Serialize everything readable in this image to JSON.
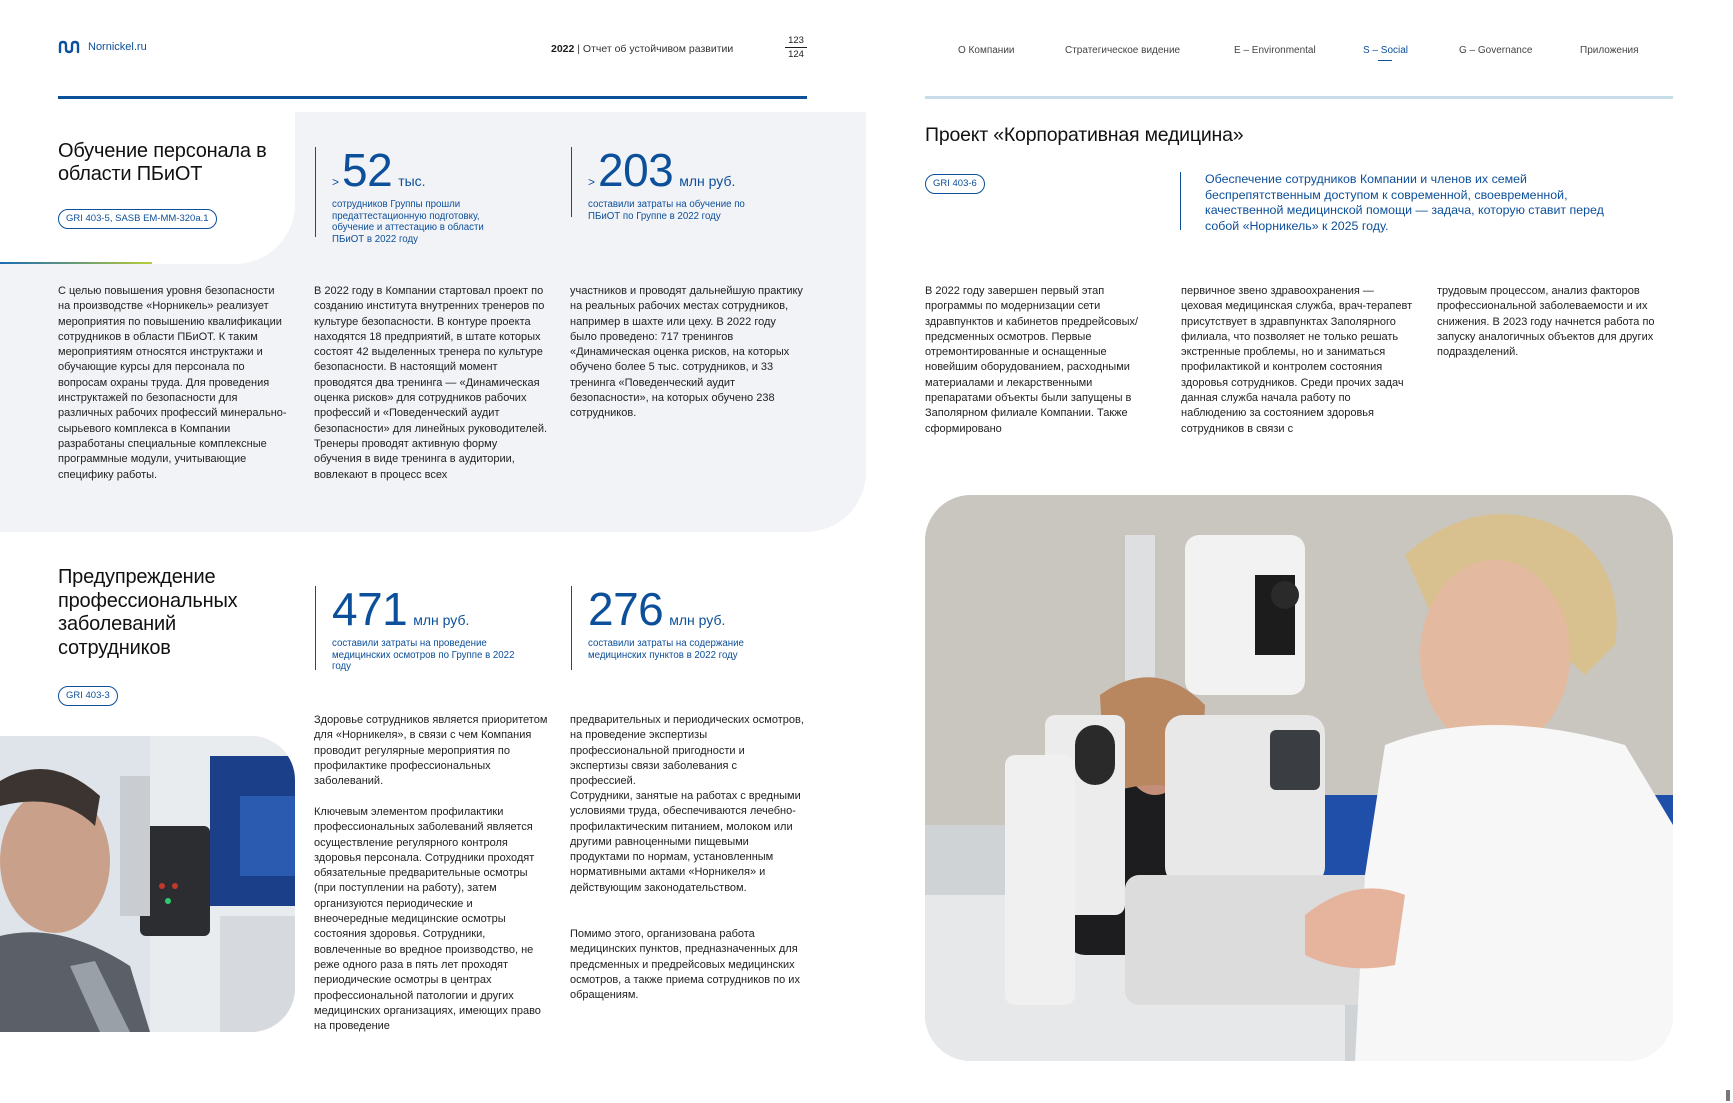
{
  "header": {
    "site": "Nornickel.ru",
    "year": "2022",
    "report_title": "Отчет об устойчивом развитии",
    "page_top": "123",
    "page_bottom": "124",
    "nav": [
      "О Компании",
      "Стратегическое видение",
      "E – Environmental",
      "S – Social",
      "G – Governance",
      "Приложения"
    ],
    "nav_active_index": 3
  },
  "colors": {
    "brand": "#0c4f9a",
    "panel": "#f2f3f6",
    "rule_right": "#c8dbe8"
  },
  "training": {
    "title": "Обучение персонала в области ПБиОТ",
    "tag": "GRI 403-5, SASB EM-MM-320a.1",
    "stat1": {
      "prefix": ">",
      "value": "52",
      "unit": "тыс.",
      "caption": "сотрудников Группы прошли предаттестационную подготовку, обучение и аттестацию в области ПБиОТ в 2022 году"
    },
    "stat2": {
      "prefix": ">",
      "value": "203",
      "unit": "млн руб.",
      "caption": "составили затраты на обучение по ПБиОТ по Группе в 2022 году"
    },
    "col1": "С целью повышения уровня безопасности на производстве «Норникель» реализует мероприятия по повышению квалификации сотрудников в области ПБиОТ. К таким мероприятиям относятся инструктажи и обучающие курсы для персонала по вопросам охраны труда. Для проведения инструктажей по безопасности для различных рабочих профессий минерально-сырьевого комплекса в Компании разработаны специальные комплексные программные модули, учитывающие специфику работы.",
    "col2": "В 2022 году в Компании стартовал проект по созданию института внутренних тренеров по культуре безопасности. В контуре проекта находятся 18 предприятий, в штате которых состоят 42 выделенных тренера по культуре безопасности. В настоящий момент проводятся два тренинга — «Динамическая оценка рисков» для сотрудников рабочих профессий и «Поведенческий аудит безопасности» для линейных руководителей. Тренеры проводят активную форму обучения в виде тренинга в аудитории, вовлекают в процесс всех",
    "col3": "участников и проводят дальнейшую практику на реальных рабочих местах сотрудников, например в шахте или цеху. В 2022 году было проведено: 717 тренингов «Динамическая оценка рисков, на которых обучено более 5 тыс. сотрудников, и 33 тренинга «Поведенческий аудит безопасности», на которых обучено 238 сотрудников."
  },
  "prevention": {
    "title": "Предупреждение профессиональных заболеваний сотрудников",
    "tag": "GRI 403-3",
    "stat1": {
      "value": "471",
      "unit": "млн руб.",
      "caption": "составили затраты на проведение медицинских осмотров по Группе в 2022 году"
    },
    "stat2": {
      "value": "276",
      "unit": "млн руб.",
      "caption": "составили затраты на содержание медицинских пунктов в 2022 году"
    },
    "col1_p1": "Здоровье сотрудников является приоритетом для «Норникеля», в связи с чем Компания проводит регулярные мероприятия по профилактике профессиональных заболеваний.",
    "col1_p2": "Ключевым элементом профилактики профессиональных заболеваний является осуществление регулярного контроля здоровья персонала. Сотрудники проходят обязательные предварительные осмотры (при поступлении на работу), затем организуются периодические и внеочередные медицинские осмотры состояния здоровья. Сотрудники, вовлеченные во вредное производство, не реже одного раза в пять лет проходят периодические осмотры в центрах профессиональной патологии и других медицинских организациях, имеющих право на проведение",
    "col2_p1": "предварительных и периодических осмотров, на проведение экспертизы профессиональной пригодности и экспертизы связи заболевания с профессией.",
    "col2_p2": "Сотрудники, занятые на работах с вредными условиями труда, обеспечиваются лечебно-профилактическим питанием, молоком или другими равноценными пищевыми продуктами по нормам, установленным нормативными актами «Норникеля» и действующим законодательством.",
    "col2_p3": "Помимо этого, организована работа медицинских пунктов, предназначенных для предсменных и предрейсовых медицинских осмотров, а также приема сотрудников по их обращениям."
  },
  "medicine": {
    "title": "Проект «Корпоративная медицина»",
    "tag": "GRI 403-6",
    "quote": "Обеспечение сотрудников Компании и членов их семей беспрепятственным доступом к современной, своевременной, качественной медицинской помощи — задача, которую ставит перед собой «Норникель» к 2025 году.",
    "col1": "В 2022 году завершен первый этап программы по модернизации сети здравпунктов и кабинетов предрейсовых/предсменных осмотров. Первые отремонтированные и оснащенные новейшим оборудованием, расходными материалами и лекарственными препаратами объекты были запущены в Заполярном филиале Компании. Также сформировано",
    "col2": "первичное звено здравоохранения — цеховая медицинская служба, врач-терапевт присутствует в здравпунктах Заполярного филиала, что позволяет не только решать экстренные проблемы, но и заниматься профилактикой и контролем состояния здоровья сотрудников. Среди прочих задач данная служба начала работу по наблюдению за состоянием здоровья сотрудников в связи с",
    "col3": "трудовым процессом, анализ факторов профессиональной заболеваемости и их снижения. В 2023 году начнется работа по запуску аналогичных объектов для других подразделений."
  }
}
